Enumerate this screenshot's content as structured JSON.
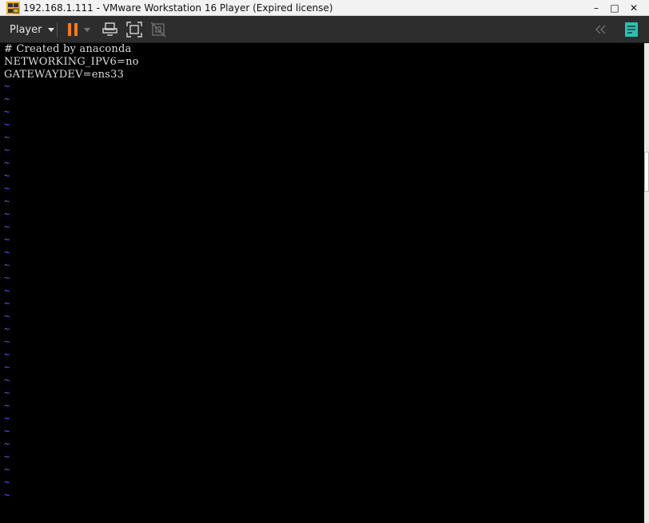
{
  "window": {
    "title": "192.168.1.111 - VMware Workstation 16 Player (Expired license)",
    "minimize": "–",
    "maximize": "□",
    "close": "✕"
  },
  "toolbar": {
    "player_label": "Player",
    "pause_icon": "pause-icon",
    "send_keys_icon": "send-ctrl-alt-del-icon",
    "fullscreen_icon": "fullscreen-icon",
    "unity_icon": "unity-icon",
    "collapse_icon": "double-chevron-left-icon",
    "library_icon": "notes-icon",
    "accent": "#f47a20",
    "teal": "#2bc1b0"
  },
  "terminal": {
    "lines": [
      "# Created by anaconda",
      "NETWORKING_IPV6=no",
      "GATEWAYDEV=ens33"
    ],
    "tilde": "~",
    "text_color": "#dcdcdc",
    "tilde_color": "#5a5aff"
  }
}
